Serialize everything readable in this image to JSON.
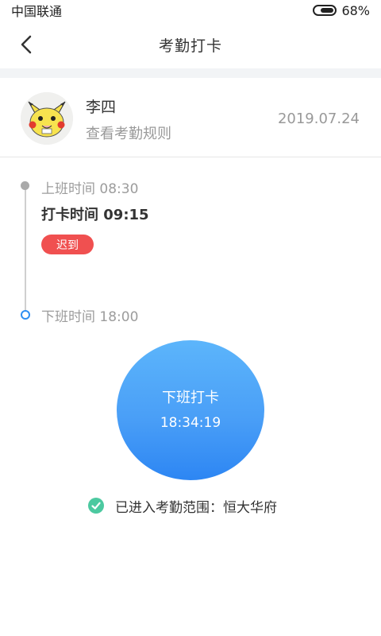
{
  "status_bar": {
    "carrier": "中国联通",
    "battery_percent": "68%",
    "battery_level": 0.68
  },
  "nav": {
    "title": "考勤打卡",
    "back_icon": "chevron-left-icon"
  },
  "user": {
    "name": "李四",
    "rules_link": "查看考勤规则",
    "date": "2019.07.24",
    "avatar_icon": "pikachu-avatar-icon"
  },
  "timeline": {
    "start_label": "上班时间 08:30",
    "punch_label": "打卡时间 09:15",
    "late_badge": "迟到",
    "end_label": "下班时间 18:00"
  },
  "punch_button": {
    "label": "下班打卡",
    "time": "18:34:19",
    "color_top": "#5cb5fb",
    "color_bottom": "#2d86f3"
  },
  "range": {
    "text": "已进入考勤范围：恒大华府",
    "status_icon": "check-circle-icon",
    "color": "#4cc9a0"
  }
}
